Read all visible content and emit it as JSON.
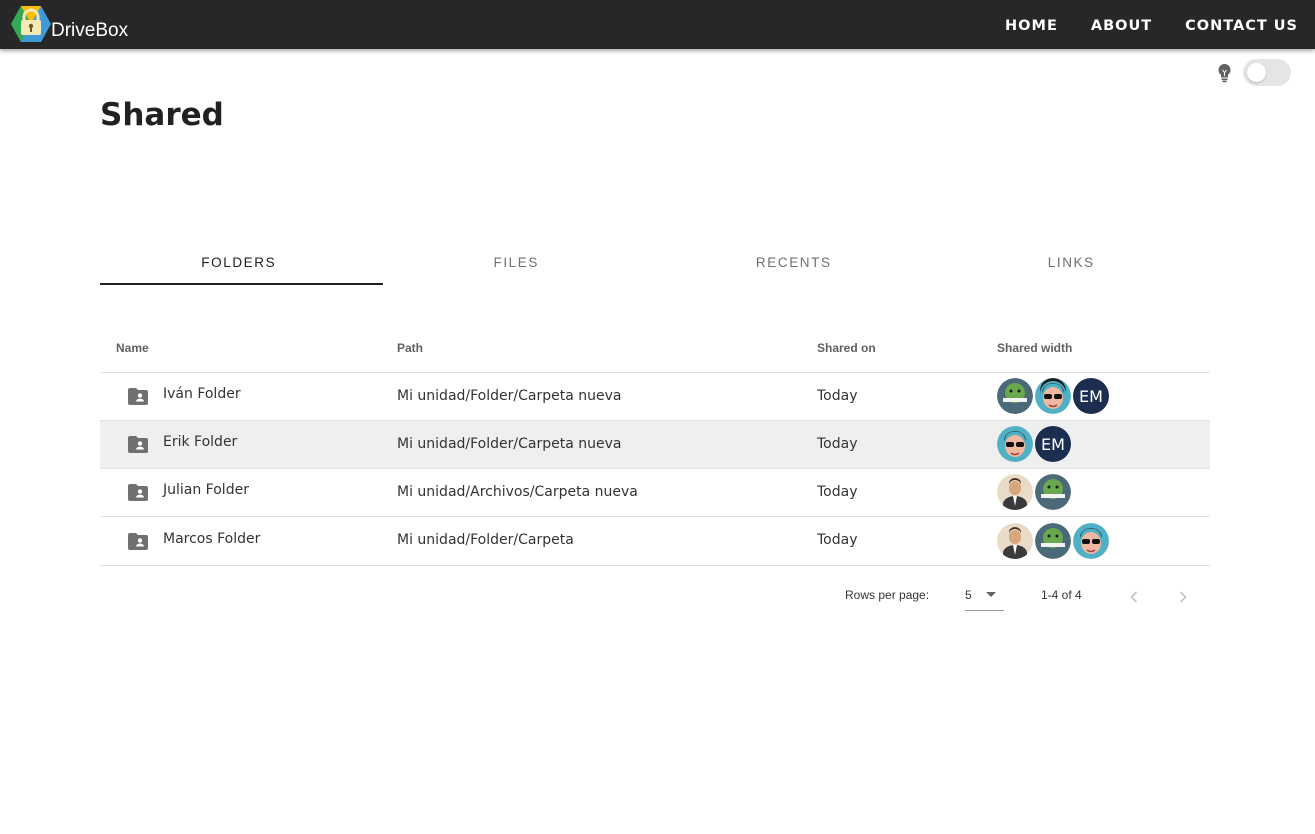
{
  "app": {
    "brand": "DriveBox",
    "nav": [
      "HOME",
      "ABOUT",
      "CONTACT US"
    ],
    "theme_toggle": {
      "on": false
    }
  },
  "page": {
    "title": "Shared"
  },
  "tabs": [
    "FOLDERS",
    "FILES",
    "RECENTS",
    "LINKS"
  ],
  "active_tab": "FOLDERS",
  "table": {
    "columns": [
      "Name",
      "Path",
      "Shared on",
      "Shared width"
    ],
    "rows": [
      {
        "name": "Iván Folder",
        "path": "Mi unidad/Folder/Carpeta nueva",
        "shared_on": "Today"
      },
      {
        "name": "Erik Folder",
        "path": "Mi unidad/Folder/Carpeta nueva",
        "shared_on": "Today"
      },
      {
        "name": "Julian Folder",
        "path": "Mi unidad/Archivos/Carpeta nueva",
        "shared_on": "Today"
      },
      {
        "name": "Marcos Folder",
        "path": "Mi unidad/Folder/Carpeta",
        "shared_on": "Today"
      }
    ],
    "avatar_initials": "EM"
  },
  "pagination": {
    "rows_per_page_label": "Rows per page:",
    "rows_per_page": "5",
    "range": "1-4 of 4"
  },
  "colors": {
    "appbar": "#272727",
    "row_hover": "#efefef",
    "avatar_initials_bg": "#1c2e4f"
  }
}
